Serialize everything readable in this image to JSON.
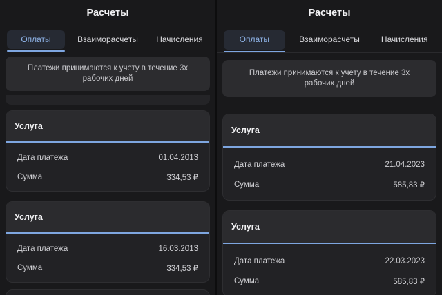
{
  "left": {
    "title": "Расчеты",
    "tabs": [
      {
        "label": "Оплаты",
        "active": true
      },
      {
        "label": "Взаиморасчеты",
        "active": false
      },
      {
        "label": "Начисления",
        "active": false
      }
    ],
    "notice": "Платежи принимаются к учету в течение 3х рабочих дней",
    "cards": [
      {
        "title": "Услуга",
        "date_label": "Дата платежа",
        "date": "01.04.2013",
        "sum_label": "Сумма",
        "sum": "334,53 ₽"
      },
      {
        "title": "Услуга",
        "date_label": "Дата платежа",
        "date": "16.03.2013",
        "sum_label": "Сумма",
        "sum": "334,53 ₽"
      }
    ]
  },
  "right": {
    "title": "Расчеты",
    "tabs": [
      {
        "label": "Оплаты",
        "active": true
      },
      {
        "label": "Взаиморасчеты",
        "active": false
      },
      {
        "label": "Начисления",
        "active": false
      }
    ],
    "notice": "Платежи принимаются к учету в течение 3х рабочих дней",
    "cards": [
      {
        "title": "Услуга",
        "date_label": "Дата платежа",
        "date": "21.04.2023",
        "sum_label": "Сумма",
        "sum": "585,83 ₽"
      },
      {
        "title": "Услуга",
        "date_label": "Дата платежа",
        "date": "22.03.2023",
        "sum_label": "Сумма",
        "sum": "585,83 ₽"
      }
    ]
  },
  "colors": {
    "accent": "#7ea6e0",
    "background": "#19191b",
    "card": "#222225"
  }
}
